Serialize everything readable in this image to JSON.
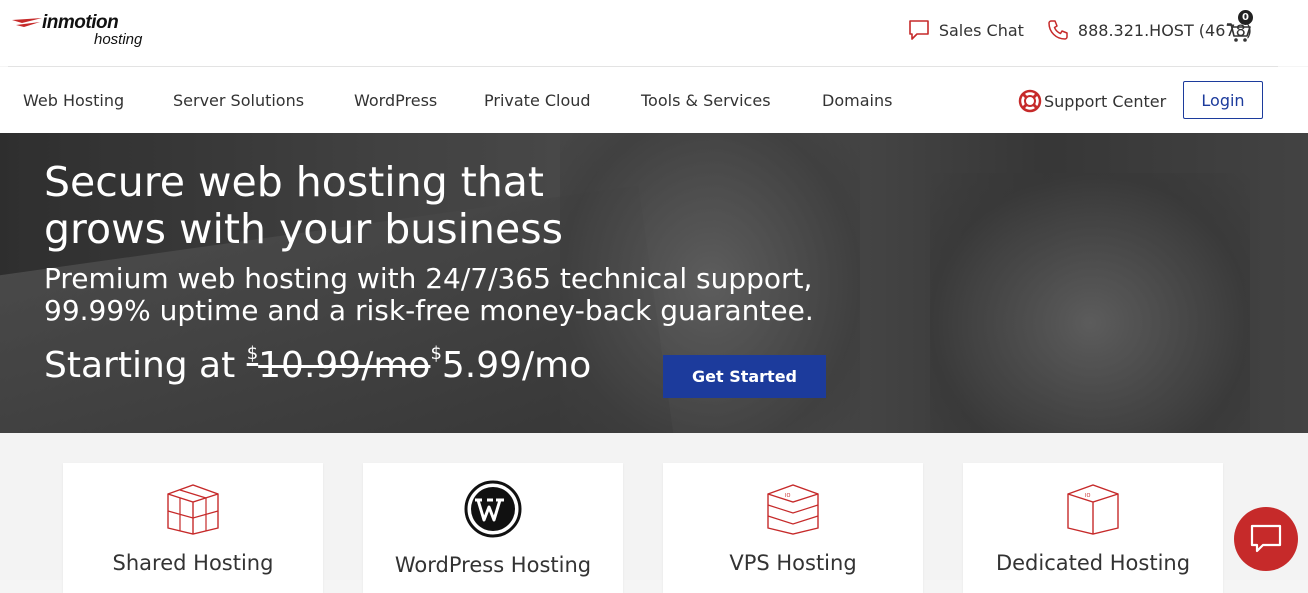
{
  "brand": {
    "name": "inmotion",
    "sub": "hosting",
    "logo_icon": "swoosh-logo",
    "accent_color": "#c62a2a",
    "primary_color": "#1c3b9c"
  },
  "top_bar": {
    "sales_chat": {
      "label": "Sales Chat",
      "icon": "chat-bubble-icon"
    },
    "phone": {
      "label": "888.321.HOST (4678)",
      "icon": "phone-icon"
    },
    "cart": {
      "count": "0",
      "icon": "cart-icon"
    }
  },
  "nav": {
    "items": [
      {
        "label": "Web Hosting"
      },
      {
        "label": "Server Solutions"
      },
      {
        "label": "WordPress"
      },
      {
        "label": "Private Cloud"
      },
      {
        "label": "Tools & Services"
      },
      {
        "label": "Domains"
      }
    ],
    "support": {
      "label": "Support Center",
      "icon": "lifebuoy-icon"
    },
    "login": {
      "label": "Login"
    }
  },
  "hero": {
    "title": "Secure web hosting that grows with your business",
    "subtitle": "Premium web hosting with 24/7/365 technical support, 99.99% uptime and a risk-free money-back guarantee.",
    "price_prefix": "Starting at",
    "currency": "$",
    "old_price": "10.99/mo",
    "new_price": "5.99/mo",
    "cta": "Get Started"
  },
  "cards": [
    {
      "label": "Shared Hosting",
      "icon": "cube-grid-icon"
    },
    {
      "label": "WordPress Hosting",
      "icon": "wordpress-icon"
    },
    {
      "label": "VPS Hosting",
      "icon": "server-box-icon"
    },
    {
      "label": "Dedicated Hosting",
      "icon": "box-icon"
    }
  ],
  "chat_widget": {
    "icon": "chat-widget-icon"
  }
}
